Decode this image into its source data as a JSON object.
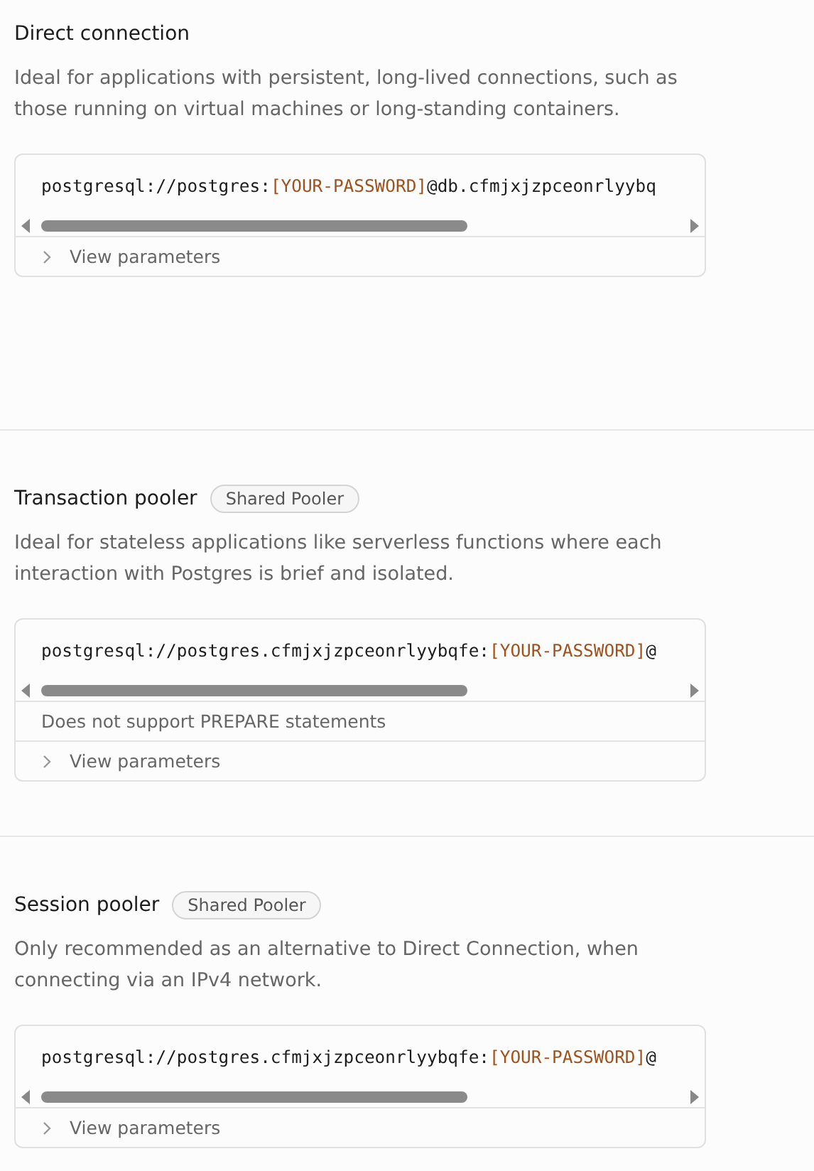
{
  "sections": [
    {
      "title": "Direct connection",
      "description": "Ideal for applications with persistent, long-lived connections, such as those running on virtual machines or long-standing containers.",
      "connection_string": [
        {
          "kind": "plain",
          "text": "postgresql://postgres:"
        },
        {
          "kind": "placeholder",
          "text": "[YOUR-PASSWORD]"
        },
        {
          "kind": "plain",
          "text": "@db.cfmjxjzpceonrlyybq"
        }
      ],
      "parameters_label": "View parameters",
      "expanded": false
    },
    {
      "title": "Transaction pooler",
      "badge": "Shared Pooler",
      "description": "Ideal for stateless applications like serverless functions where each interaction with Postgres is brief and isolated.",
      "connection_string": [
        {
          "kind": "plain",
          "text": "postgresql://postgres.cfmjxjzpceonrlyybqfe:"
        },
        {
          "kind": "placeholder",
          "text": "[YOUR-PASSWORD]"
        },
        {
          "kind": "plain",
          "text": "@"
        }
      ],
      "note": "Does not support PREPARE statements",
      "parameters_label": "View parameters",
      "expanded": false
    },
    {
      "title": "Session pooler",
      "badge": "Shared Pooler",
      "description": "Only recommended as an alternative to Direct Connection, when connecting via an IPv4 network.",
      "connection_string": [
        {
          "kind": "plain",
          "text": "postgresql://postgres.cfmjxjzpceonrlyybqfe:"
        },
        {
          "kind": "placeholder",
          "text": "[YOUR-PASSWORD]"
        },
        {
          "kind": "plain",
          "text": "@"
        }
      ],
      "parameters_label": "View parameters",
      "expanded": false
    }
  ]
}
